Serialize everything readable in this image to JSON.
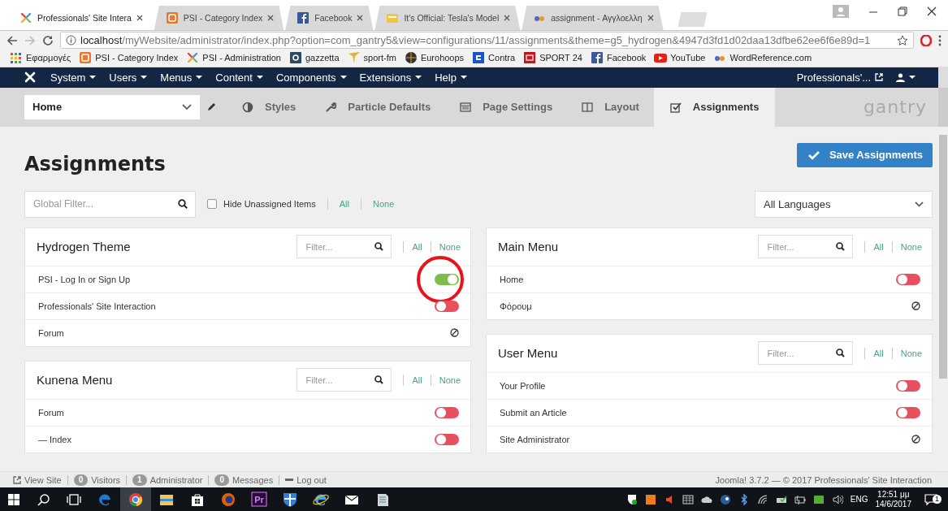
{
  "browser": {
    "tabs": [
      {
        "title": "Professionals' Site Intera",
        "kind": "joomla",
        "selected": true
      },
      {
        "title": "PSI - Category Index",
        "kind": "psi",
        "selected": false
      },
      {
        "title": "Facebook",
        "kind": "facebook",
        "selected": false
      },
      {
        "title": "It's Official: Tesla's Model",
        "kind": "folder",
        "selected": false
      },
      {
        "title": "assignment - Αγγλοελλη",
        "kind": "wordreference",
        "selected": false
      }
    ],
    "address": {
      "host": "localhost",
      "path": "/myWebsite/administrator/index.php?option=com_gantry5&view=configurations/11/assignments&theme=g5_hydrogen&4947d3fd1d02daa13dfbe62ee6f6e89d=1"
    },
    "bookmarks": [
      {
        "label": "Εφαρμογές",
        "kind": "apps"
      },
      {
        "label": "PSI - Category Index",
        "kind": "psi"
      },
      {
        "label": "PSI - Administration",
        "kind": "joomla"
      },
      {
        "label": "gazzetta",
        "kind": "gazzetta"
      },
      {
        "label": "sport-fm",
        "kind": "sportfm"
      },
      {
        "label": "Eurohoops",
        "kind": "eurohoops"
      },
      {
        "label": "Contra",
        "kind": "contra"
      },
      {
        "label": "SPORT 24",
        "kind": "sport24"
      },
      {
        "label": "Facebook",
        "kind": "facebook"
      },
      {
        "label": "YouTube",
        "kind": "youtube"
      },
      {
        "label": "WordReference.com",
        "kind": "wordreference"
      }
    ]
  },
  "admin_menu": {
    "items": [
      "System",
      "Users",
      "Menus",
      "Content",
      "Components",
      "Extensions",
      "Help"
    ],
    "site_link": "Professionals'..."
  },
  "gantry": {
    "outline": "Home",
    "tabs": [
      {
        "label": "Styles",
        "kind": "styles",
        "selected": false
      },
      {
        "label": "Particle Defaults",
        "kind": "particles",
        "selected": false
      },
      {
        "label": "Page Settings",
        "kind": "page",
        "selected": false
      },
      {
        "label": "Layout",
        "kind": "layout",
        "selected": false
      },
      {
        "label": "Assignments",
        "kind": "assignments",
        "selected": true
      }
    ],
    "logo": "gantry"
  },
  "page": {
    "title": "Assignments",
    "save_button": "Save Assignments",
    "global_filter": {
      "placeholder": "Global Filter..."
    },
    "hide_unassigned": {
      "label": "Hide Unassigned Items",
      "checked": false
    },
    "all_link": "All",
    "none_link": "None",
    "language": "All Languages",
    "columns": [
      [
        {
          "title": "Hydrogen Theme",
          "filter_placeholder": "Filter...",
          "all": "All",
          "none": "None",
          "items": [
            {
              "label": "PSI - Log In or Sign Up",
              "kind": "toggle",
              "on": true,
              "highlighted": true
            },
            {
              "label": "Professionals' Site Interaction",
              "kind": "toggle",
              "on": false,
              "highlighted": false
            },
            {
              "label": "Forum",
              "kind": "unavailable",
              "highlighted": false
            }
          ]
        },
        {
          "title": "Kunena Menu",
          "filter_placeholder": "Filter...",
          "all": "All",
          "none": "None",
          "items": [
            {
              "label": "Forum",
              "kind": "toggle",
              "on": false,
              "highlighted": false
            },
            {
              "label": "— Index",
              "kind": "toggle",
              "on": false,
              "highlighted": false
            }
          ]
        }
      ],
      [
        {
          "title": "Main Menu",
          "filter_placeholder": "Filter...",
          "all": "All",
          "none": "None",
          "items": [
            {
              "label": "Home",
              "kind": "toggle",
              "on": false,
              "highlighted": false
            },
            {
              "label": "Φόρουμ",
              "kind": "unavailable",
              "highlighted": false
            }
          ]
        },
        {
          "title": "User Menu",
          "filter_placeholder": "Filter...",
          "all": "All",
          "none": "None",
          "items": [
            {
              "label": "Your Profile",
              "kind": "toggle",
              "on": false,
              "highlighted": false
            },
            {
              "label": "Submit an Article",
              "kind": "toggle",
              "on": false,
              "highlighted": false
            },
            {
              "label": "Site Administrator",
              "kind": "unavailable",
              "highlighted": false
            }
          ]
        }
      ]
    ]
  },
  "status_bar": {
    "view_site": "View Site",
    "counters": [
      {
        "count": "0",
        "label": "Visitors"
      },
      {
        "count": "1",
        "label": "Administrator"
      },
      {
        "count": "0",
        "label": "Messages"
      }
    ],
    "logout": "Log out",
    "footer": "Joomla! 3.7.2 — © 2017 Professionals' Site Interaction"
  },
  "taskbar": {
    "apps": [
      {
        "kind": "search",
        "selected": false
      },
      {
        "kind": "taskview",
        "selected": false
      },
      {
        "kind": "edge",
        "selected": false
      },
      {
        "kind": "chrome",
        "selected": true
      },
      {
        "kind": "folder",
        "selected": false
      },
      {
        "kind": "store",
        "selected": false
      },
      {
        "kind": "firefox",
        "selected": false
      },
      {
        "kind": "premiere",
        "label": "Pr",
        "selected": false
      },
      {
        "kind": "shield",
        "selected": false
      },
      {
        "kind": "ie",
        "selected": false
      },
      {
        "kind": "mail",
        "selected": false
      },
      {
        "kind": "notes",
        "selected": false
      }
    ],
    "language": "ENG",
    "time": "12:51 μμ",
    "date": "14/6/2017",
    "notifications": "1"
  }
}
